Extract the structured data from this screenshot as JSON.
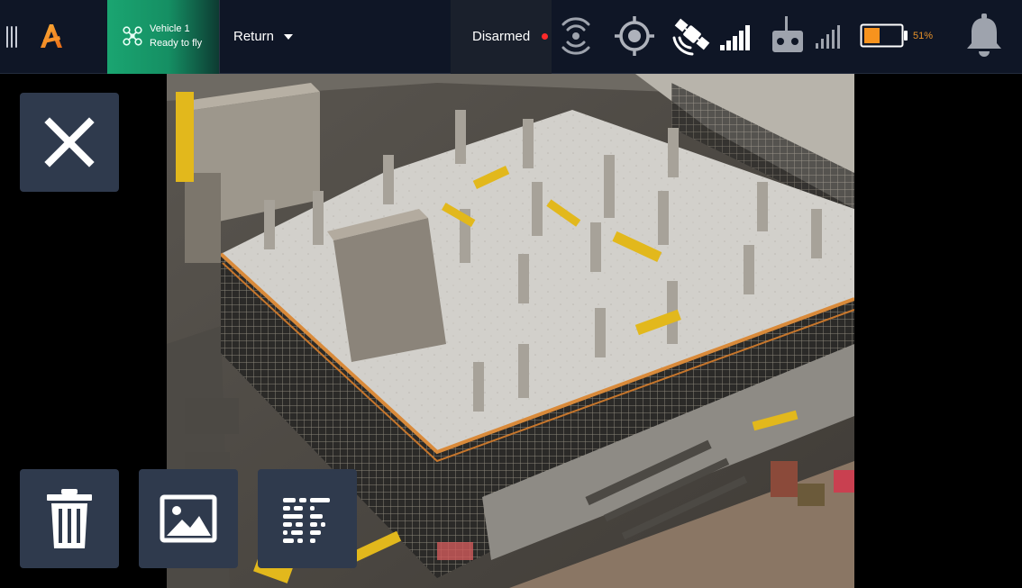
{
  "app": {
    "logo": "app-logo"
  },
  "header": {
    "menu_icon": "hamburger-icon",
    "vehicle": {
      "name": "Vehicle 1",
      "status": "Ready to fly",
      "icon": "drone-icon",
      "accent_color": "#1aa571"
    },
    "flight_mode": {
      "selected": "Return",
      "icon": "chevron-down-icon"
    },
    "arm_state": {
      "label": "Disarmed",
      "indicator_color": "#ff2a2a"
    },
    "indicators": [
      {
        "name": "rtk-signal-icon"
      },
      {
        "name": "gps-lock-icon"
      },
      {
        "name": "satellite-icon",
        "signal_bars": 5
      },
      {
        "name": "remote-controller-icon",
        "signal_bars": 5
      },
      {
        "name": "battery-icon",
        "level": 0.51
      },
      {
        "name": "notifications-bell-icon"
      }
    ],
    "battery": {
      "percent_label": "51%",
      "color": "#e8922a"
    }
  },
  "viewer": {
    "content": "photo-aerial-construction-site"
  },
  "actions": {
    "close": {
      "icon": "close-icon"
    },
    "delete": {
      "icon": "trash-icon"
    },
    "gallery": {
      "icon": "image-gallery-icon"
    },
    "details": {
      "icon": "layout-list-icon"
    }
  }
}
